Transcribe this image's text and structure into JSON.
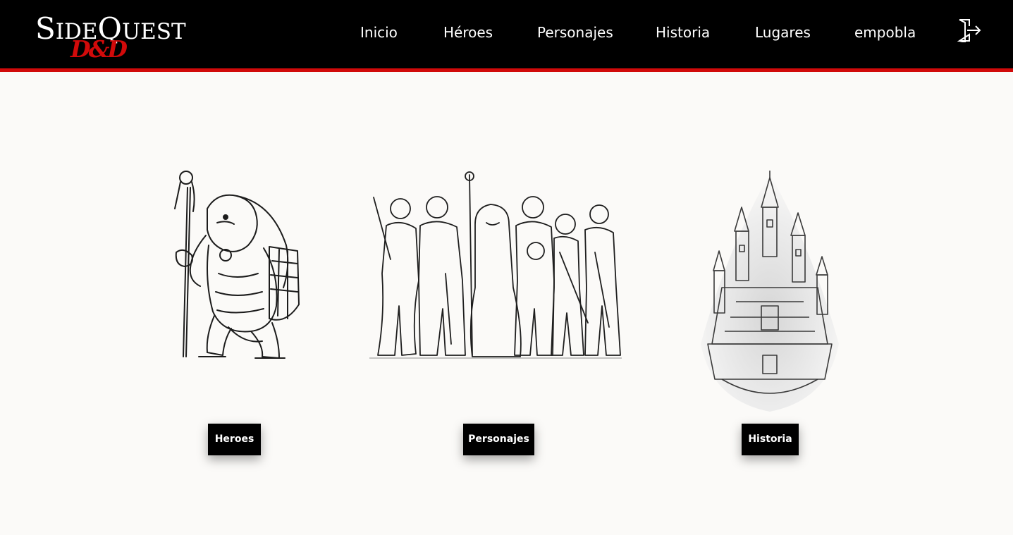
{
  "brand": {
    "logo_text_big_1": "S",
    "logo_text_small_1": "IDE",
    "logo_text_big_2": "Q",
    "logo_text_small_2": "UEST",
    "logo_emblem": "D&D"
  },
  "nav": {
    "items": [
      {
        "label": "Inicio"
      },
      {
        "label": "Héroes"
      },
      {
        "label": "Personajes"
      },
      {
        "label": "Historia"
      },
      {
        "label": "Lugares"
      },
      {
        "label": "empobla"
      }
    ],
    "logout_icon": "logout-icon"
  },
  "cards": [
    {
      "button_label": "Heroes",
      "image_icon": "lizardfolk-sketch"
    },
    {
      "button_label": "Personajes",
      "image_icon": "party-sketch"
    },
    {
      "button_label": "Historia",
      "image_icon": "castle-sketch"
    }
  ],
  "colors": {
    "navbar": "#000000",
    "accent_red": "#d10a0a",
    "background": "#fbfaf8",
    "button": "#000000"
  }
}
